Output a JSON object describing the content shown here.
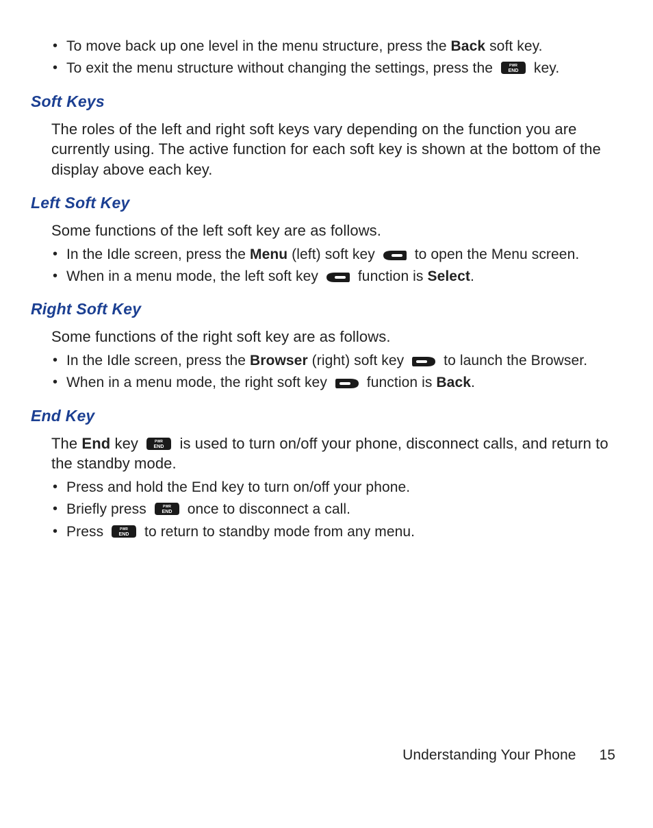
{
  "top_bullets": {
    "b1_pre": "To move back up one level in the menu structure, press the ",
    "b1_bold": "Back",
    "b1_post": " soft key.",
    "b2_pre": "To exit the menu structure without changing the settings, press the ",
    "b2_post": " key."
  },
  "soft_keys": {
    "heading": "Soft Keys",
    "para": "The roles of the left and right soft keys vary depending on the function you are currently using. The active function for each soft key is shown at the bottom of the display above each key."
  },
  "left_soft_key": {
    "heading": "Left Soft Key",
    "intro": "Some functions of the left soft key are as follows.",
    "b1_pre": "In the Idle screen, press the ",
    "b1_bold": "Menu",
    "b1_mid": " (left) soft key ",
    "b1_post": " to open the Menu screen.",
    "b2_pre": "When in a menu mode, the left soft key ",
    "b2_mid": " function is ",
    "b2_bold": "Select",
    "b2_post": "."
  },
  "right_soft_key": {
    "heading": "Right Soft Key",
    "intro": "Some functions of the right soft key are as follows.",
    "b1_pre": "In the Idle screen, press the ",
    "b1_bold": "Browser",
    "b1_mid": " (right) soft key ",
    "b1_post": " to launch the Browser.",
    "b2_pre": "When in a menu mode, the right soft key ",
    "b2_mid": " function is ",
    "b2_bold": "Back",
    "b2_post": "."
  },
  "end_key": {
    "heading": "End Key",
    "p_pre": "The ",
    "p_bold": "End",
    "p_mid": " key ",
    "p_post": " is used to turn on/off your phone, disconnect calls, and return to the standby mode.",
    "b1": "Press and hold the End key to turn on/off your phone.",
    "b2_pre": "Briefly press ",
    "b2_post": " once to disconnect a call.",
    "b3_pre": "Press ",
    "b3_post": " to return to standby mode from any menu."
  },
  "footer": {
    "section": "Understanding Your Phone",
    "page": "15"
  }
}
